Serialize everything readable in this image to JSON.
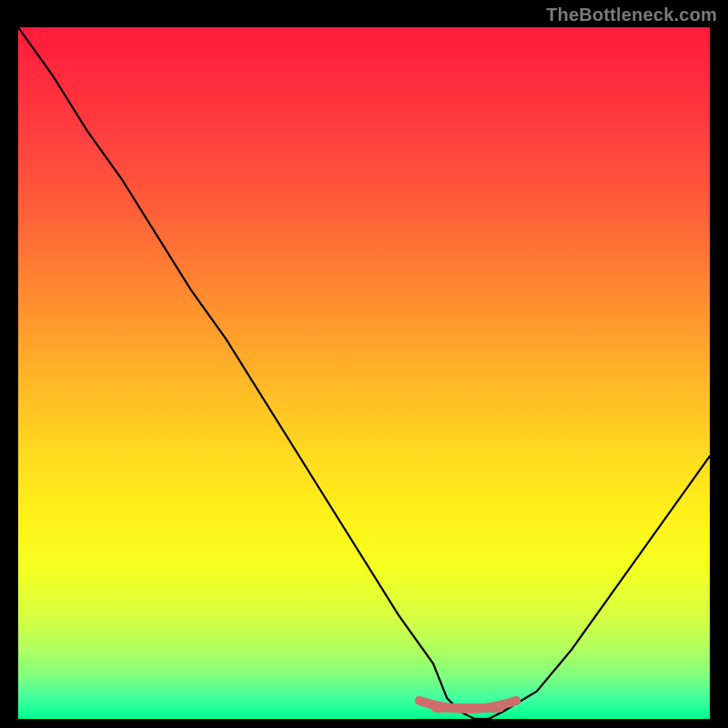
{
  "watermark": "TheBottleneck.com",
  "colors": {
    "overlay_stroke": "#cf6d6d"
  },
  "chart_data": {
    "type": "line",
    "title": "",
    "xlabel": "",
    "ylabel": "",
    "x": [
      0.0,
      0.05,
      0.1,
      0.15,
      0.2,
      0.25,
      0.3,
      0.35,
      0.4,
      0.45,
      0.5,
      0.55,
      0.6,
      0.62,
      0.64,
      0.66,
      0.68,
      0.7,
      0.75,
      0.8,
      0.85,
      0.9,
      0.95,
      1.0
    ],
    "values": [
      1.0,
      0.93,
      0.85,
      0.78,
      0.7,
      0.62,
      0.55,
      0.47,
      0.39,
      0.31,
      0.23,
      0.15,
      0.08,
      0.03,
      0.01,
      0.0,
      0.0,
      0.01,
      0.04,
      0.1,
      0.17,
      0.24,
      0.31,
      0.38
    ],
    "xlim": [
      0,
      1
    ],
    "ylim": [
      0,
      1
    ],
    "highlight_region_x": [
      0.58,
      0.72
    ],
    "legend": false,
    "grid": false
  }
}
